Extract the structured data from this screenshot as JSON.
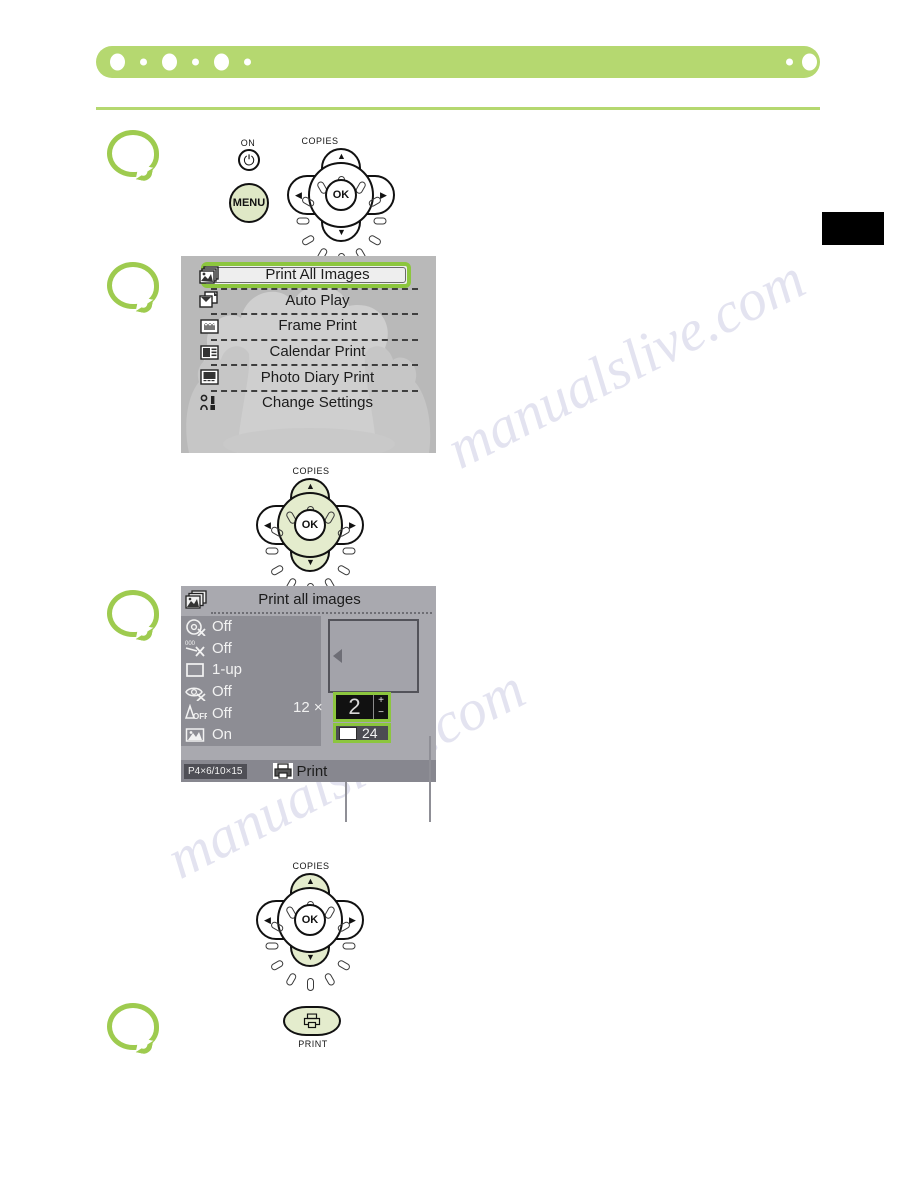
{
  "page": {
    "watermark": "manualslive.com",
    "header": {
      "bar_color": "#b5d870",
      "rule_color": "#b5d870",
      "left_dots": [
        "big",
        "small",
        "big",
        "small",
        "big",
        "small"
      ],
      "right_dots": [
        "small",
        "big",
        "small",
        "big",
        "small",
        "big"
      ]
    },
    "edge_tab": {
      "name": "chapter-tab",
      "color": "#000000"
    },
    "accent_color": "#8cc63e",
    "steps": [
      {
        "label": ""
      },
      {
        "label": ""
      },
      {
        "label": ""
      },
      {
        "label": ""
      }
    ]
  },
  "control_panel_top": {
    "on_label": "ON",
    "on_icon": "power-icon",
    "on_glyph": "⏻",
    "menu_label": "MENU",
    "dial": {
      "copies_label": "COPIES",
      "ok_label": "OK",
      "up_glyph": "▲",
      "down_glyph": "▼",
      "left_glyph": "◀",
      "right_glyph": "▶",
      "plus_glyph": "+",
      "minus_glyph": "−"
    }
  },
  "menu_screen": {
    "items": [
      {
        "label": "Print All Images",
        "icon": "stacked-photos-icon",
        "selected": true
      },
      {
        "label": "Auto Play",
        "icon": "auto-play-icon",
        "selected": false
      },
      {
        "label": "Frame Print",
        "icon": "frame-print-icon",
        "selected": false
      },
      {
        "label": "Calendar Print",
        "icon": "calendar-print-icon",
        "selected": false
      },
      {
        "label": "Photo Diary Print",
        "icon": "photo-diary-icon",
        "selected": false
      },
      {
        "label": "Change Settings",
        "icon": "change-settings-icon",
        "selected": false
      }
    ]
  },
  "dial_step_2": {
    "copies_label": "COPIES",
    "ok_label": "OK",
    "highlight": "up-down-and-center"
  },
  "print_screen": {
    "title": "Print all images",
    "title_icon": "stacked-photos-icon",
    "settings": [
      {
        "icon": "red-eye-correction-icon",
        "value": "Off"
      },
      {
        "icon": "date-print-icon",
        "value": "Off"
      },
      {
        "icon": "layout-icon",
        "value": "1-up"
      },
      {
        "icon": "image-optimize-icon",
        "value": "Off"
      },
      {
        "icon": "brightness-icon",
        "value": "Off"
      },
      {
        "icon": "my-colors-icon",
        "value": "On"
      }
    ],
    "preview": {
      "icon": "preview-arrow-icon"
    },
    "count_multiplier": "12 ×",
    "copies_value": "2",
    "plus_label": "+",
    "minus_label": "−",
    "total_value": "24",
    "total_icon": "sheet-icon",
    "paper_size": "P4×6/10×15",
    "print_action": "Print",
    "print_action_icon": "printer-icon"
  },
  "dial_step_3": {
    "copies_label": "COPIES",
    "ok_label": "OK",
    "highlight": "up-down"
  },
  "print_button": {
    "label": "PRINT",
    "icon": "printer-icon"
  }
}
